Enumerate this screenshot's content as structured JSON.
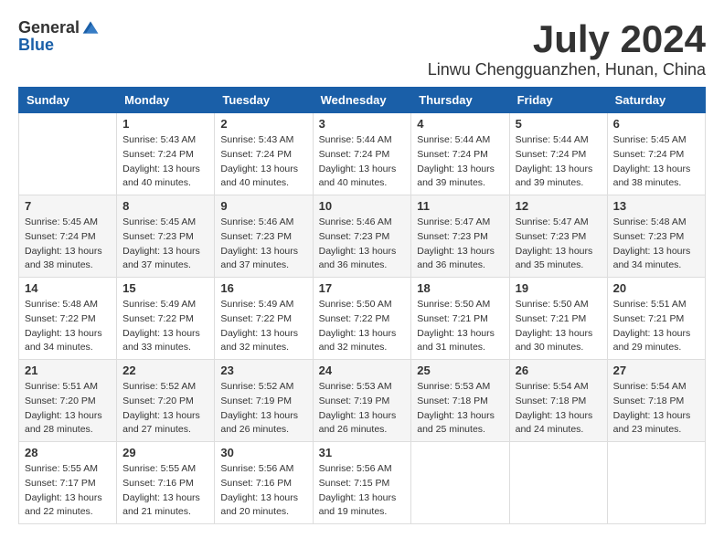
{
  "header": {
    "logo_general": "General",
    "logo_blue": "Blue",
    "month_title": "July 2024",
    "location": "Linwu Chengguanzhen, Hunan, China"
  },
  "weekdays": [
    "Sunday",
    "Monday",
    "Tuesday",
    "Wednesday",
    "Thursday",
    "Friday",
    "Saturday"
  ],
  "weeks": [
    [
      {
        "day": "",
        "info": ""
      },
      {
        "day": "1",
        "info": "Sunrise: 5:43 AM\nSunset: 7:24 PM\nDaylight: 13 hours\nand 40 minutes."
      },
      {
        "day": "2",
        "info": "Sunrise: 5:43 AM\nSunset: 7:24 PM\nDaylight: 13 hours\nand 40 minutes."
      },
      {
        "day": "3",
        "info": "Sunrise: 5:44 AM\nSunset: 7:24 PM\nDaylight: 13 hours\nand 40 minutes."
      },
      {
        "day": "4",
        "info": "Sunrise: 5:44 AM\nSunset: 7:24 PM\nDaylight: 13 hours\nand 39 minutes."
      },
      {
        "day": "5",
        "info": "Sunrise: 5:44 AM\nSunset: 7:24 PM\nDaylight: 13 hours\nand 39 minutes."
      },
      {
        "day": "6",
        "info": "Sunrise: 5:45 AM\nSunset: 7:24 PM\nDaylight: 13 hours\nand 38 minutes."
      }
    ],
    [
      {
        "day": "7",
        "info": "Sunrise: 5:45 AM\nSunset: 7:24 PM\nDaylight: 13 hours\nand 38 minutes."
      },
      {
        "day": "8",
        "info": "Sunrise: 5:45 AM\nSunset: 7:23 PM\nDaylight: 13 hours\nand 37 minutes."
      },
      {
        "day": "9",
        "info": "Sunrise: 5:46 AM\nSunset: 7:23 PM\nDaylight: 13 hours\nand 37 minutes."
      },
      {
        "day": "10",
        "info": "Sunrise: 5:46 AM\nSunset: 7:23 PM\nDaylight: 13 hours\nand 36 minutes."
      },
      {
        "day": "11",
        "info": "Sunrise: 5:47 AM\nSunset: 7:23 PM\nDaylight: 13 hours\nand 36 minutes."
      },
      {
        "day": "12",
        "info": "Sunrise: 5:47 AM\nSunset: 7:23 PM\nDaylight: 13 hours\nand 35 minutes."
      },
      {
        "day": "13",
        "info": "Sunrise: 5:48 AM\nSunset: 7:23 PM\nDaylight: 13 hours\nand 34 minutes."
      }
    ],
    [
      {
        "day": "14",
        "info": "Sunrise: 5:48 AM\nSunset: 7:22 PM\nDaylight: 13 hours\nand 34 minutes."
      },
      {
        "day": "15",
        "info": "Sunrise: 5:49 AM\nSunset: 7:22 PM\nDaylight: 13 hours\nand 33 minutes."
      },
      {
        "day": "16",
        "info": "Sunrise: 5:49 AM\nSunset: 7:22 PM\nDaylight: 13 hours\nand 32 minutes."
      },
      {
        "day": "17",
        "info": "Sunrise: 5:50 AM\nSunset: 7:22 PM\nDaylight: 13 hours\nand 32 minutes."
      },
      {
        "day": "18",
        "info": "Sunrise: 5:50 AM\nSunset: 7:21 PM\nDaylight: 13 hours\nand 31 minutes."
      },
      {
        "day": "19",
        "info": "Sunrise: 5:50 AM\nSunset: 7:21 PM\nDaylight: 13 hours\nand 30 minutes."
      },
      {
        "day": "20",
        "info": "Sunrise: 5:51 AM\nSunset: 7:21 PM\nDaylight: 13 hours\nand 29 minutes."
      }
    ],
    [
      {
        "day": "21",
        "info": "Sunrise: 5:51 AM\nSunset: 7:20 PM\nDaylight: 13 hours\nand 28 minutes."
      },
      {
        "day": "22",
        "info": "Sunrise: 5:52 AM\nSunset: 7:20 PM\nDaylight: 13 hours\nand 27 minutes."
      },
      {
        "day": "23",
        "info": "Sunrise: 5:52 AM\nSunset: 7:19 PM\nDaylight: 13 hours\nand 26 minutes."
      },
      {
        "day": "24",
        "info": "Sunrise: 5:53 AM\nSunset: 7:19 PM\nDaylight: 13 hours\nand 26 minutes."
      },
      {
        "day": "25",
        "info": "Sunrise: 5:53 AM\nSunset: 7:18 PM\nDaylight: 13 hours\nand 25 minutes."
      },
      {
        "day": "26",
        "info": "Sunrise: 5:54 AM\nSunset: 7:18 PM\nDaylight: 13 hours\nand 24 minutes."
      },
      {
        "day": "27",
        "info": "Sunrise: 5:54 AM\nSunset: 7:18 PM\nDaylight: 13 hours\nand 23 minutes."
      }
    ],
    [
      {
        "day": "28",
        "info": "Sunrise: 5:55 AM\nSunset: 7:17 PM\nDaylight: 13 hours\nand 22 minutes."
      },
      {
        "day": "29",
        "info": "Sunrise: 5:55 AM\nSunset: 7:16 PM\nDaylight: 13 hours\nand 21 minutes."
      },
      {
        "day": "30",
        "info": "Sunrise: 5:56 AM\nSunset: 7:16 PM\nDaylight: 13 hours\nand 20 minutes."
      },
      {
        "day": "31",
        "info": "Sunrise: 5:56 AM\nSunset: 7:15 PM\nDaylight: 13 hours\nand 19 minutes."
      },
      {
        "day": "",
        "info": ""
      },
      {
        "day": "",
        "info": ""
      },
      {
        "day": "",
        "info": ""
      }
    ]
  ]
}
